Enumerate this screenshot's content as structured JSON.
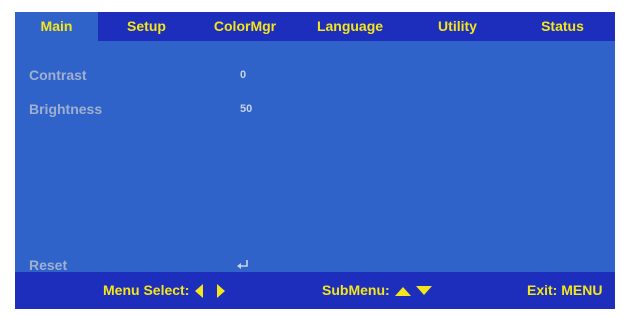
{
  "tabs": [
    {
      "label": "Main",
      "active": true
    },
    {
      "label": "Setup",
      "active": false
    },
    {
      "label": "ColorMgr",
      "active": false
    },
    {
      "label": "Language",
      "active": false
    },
    {
      "label": "Utility",
      "active": false
    },
    {
      "label": "Status",
      "active": false
    }
  ],
  "settings": {
    "contrast": {
      "label": "Contrast",
      "value": "0"
    },
    "brightness": {
      "label": "Brightness",
      "value": "50"
    },
    "reset": {
      "label": "Reset",
      "icon": "enter-icon"
    }
  },
  "footer": {
    "menu_select": "Menu Select:",
    "submenu": "SubMenu:",
    "exit": "Exit: MENU"
  },
  "colors": {
    "panel": "#2f63c9",
    "bar": "#1c2ebb",
    "accent": "#f5e51c",
    "label": "#9fb0cf"
  }
}
